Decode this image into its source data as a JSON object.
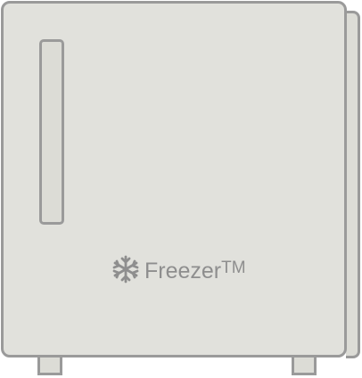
{
  "appliance": {
    "brand_name": "Freezer",
    "trademark": "TM",
    "icon": "snowflake-icon"
  },
  "colors": {
    "body": "#e1e1dc",
    "outline": "#9a9a9a",
    "brand_text": "#8e8e8e"
  }
}
